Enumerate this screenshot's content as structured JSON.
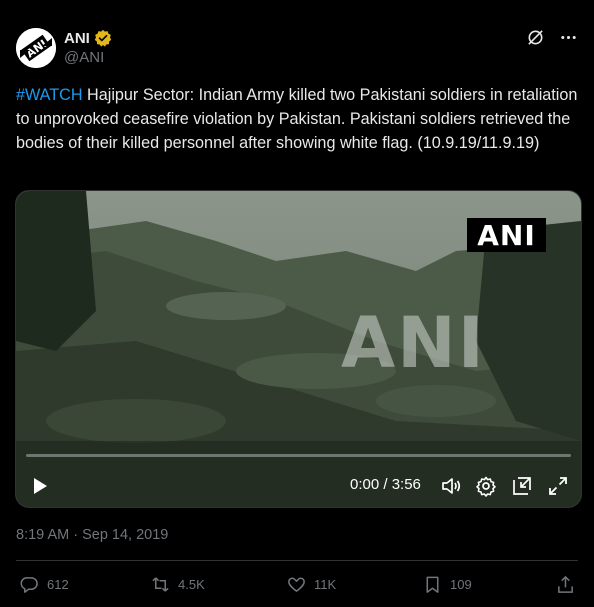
{
  "author": {
    "name": "ANI",
    "handle": "@ANI",
    "avatar_text": "ANI"
  },
  "tweet": {
    "hashtag": "#WATCH",
    "body": " Hajipur Sector: Indian Army killed two Pakistani soldiers in retaliation to unprovoked ceasefire violation by Pakistan. Pakistani soldiers retrieved the bodies of their killed personnel after showing white flag. (10.9.19/11.9.19)",
    "timestamp": "8:19 AM · Sep 14, 2019"
  },
  "video": {
    "logo_text": "ANI",
    "watermark_text": "ANI",
    "time": "0:00 / 3:56",
    "progress": 0
  },
  "actions": {
    "replies": "612",
    "reposts": "4.5K",
    "likes": "11K",
    "bookmarks": "109"
  },
  "colors": {
    "background": "#000000",
    "text": "#e7e9ea",
    "muted": "#71767b",
    "link": "#1d9bf0",
    "verified": "#e2b719"
  }
}
